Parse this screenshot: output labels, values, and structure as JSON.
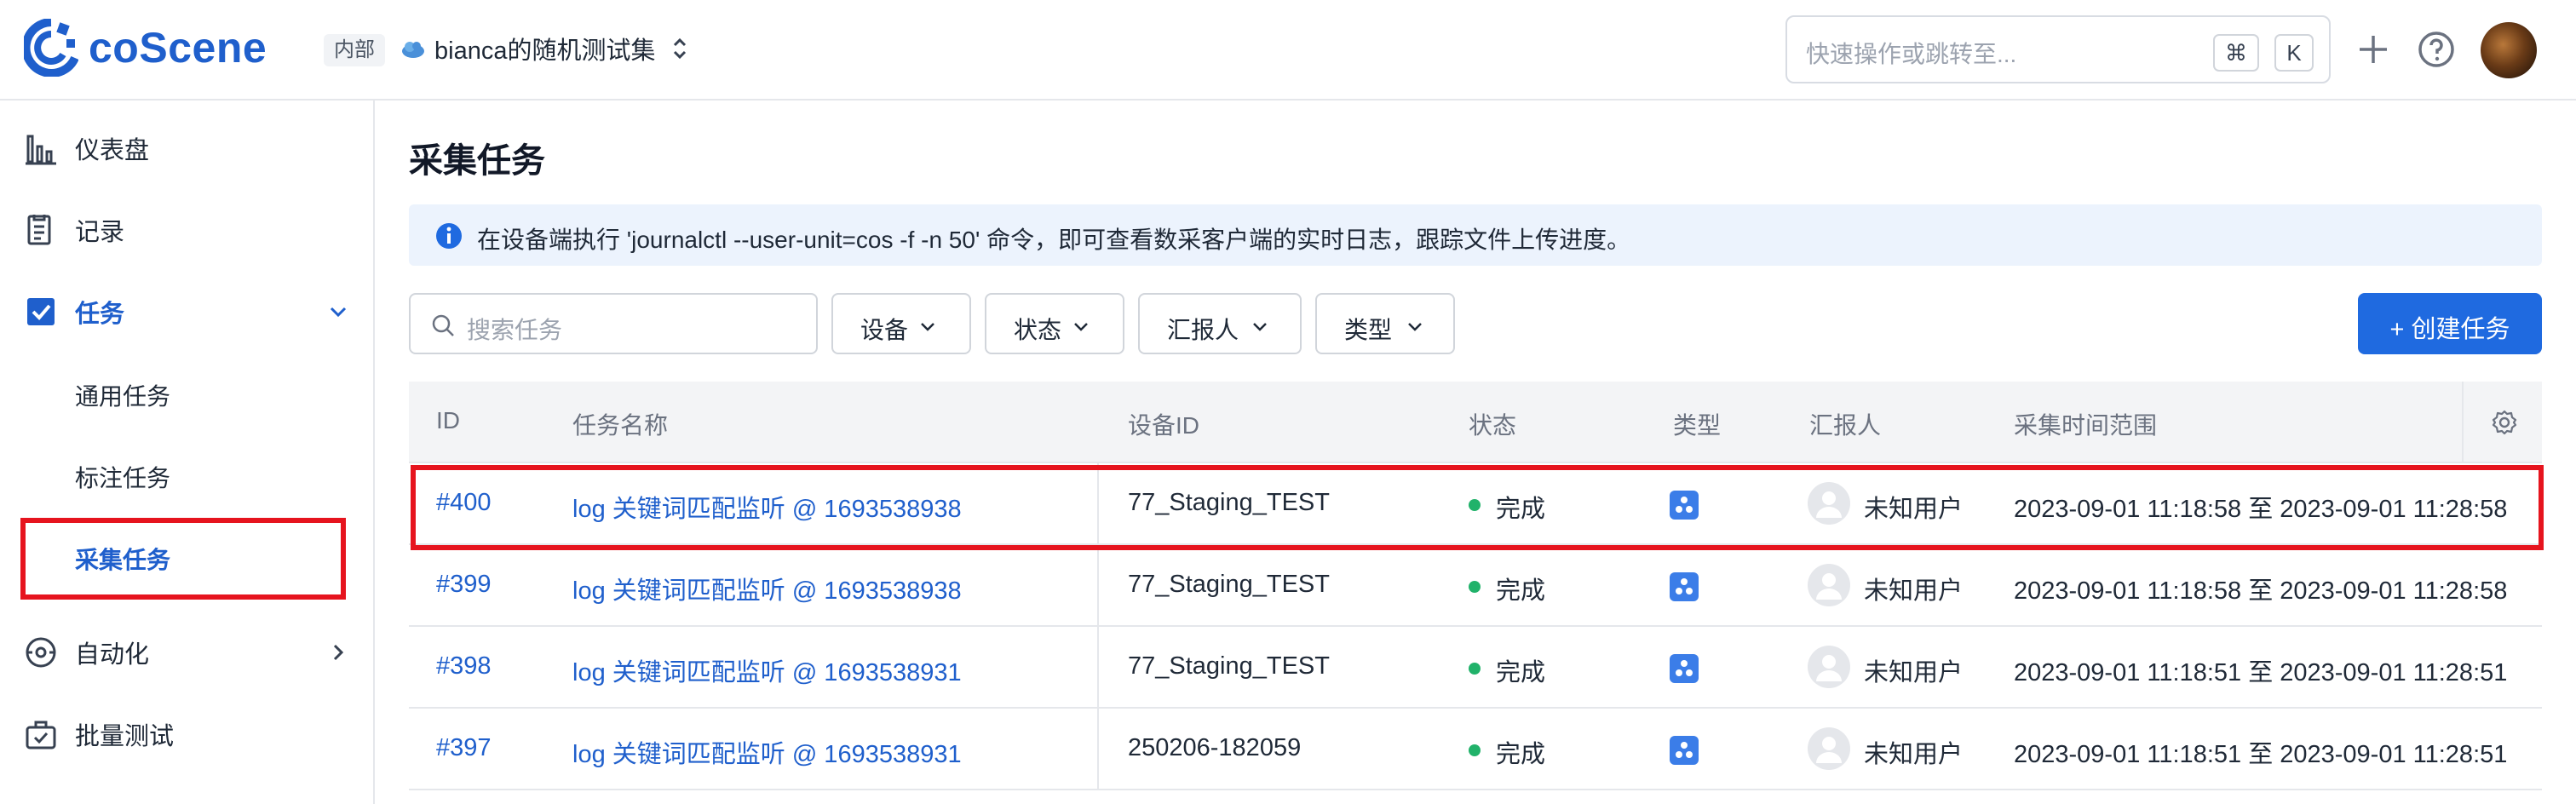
{
  "header": {
    "brand": "coScene",
    "badge": "内部",
    "project_name": "bianca的随机测试集",
    "search_placeholder": "快速操作或跳转至...",
    "shortcut_cmd": "⌘",
    "shortcut_key": "K"
  },
  "sidebar": {
    "items": [
      {
        "label": "仪表盘",
        "icon": "chart-bars-icon"
      },
      {
        "label": "记录",
        "icon": "document-icon"
      },
      {
        "label": "任务",
        "icon": "task-check-icon"
      },
      {
        "label": "自动化",
        "icon": "automation-icon"
      },
      {
        "label": "批量测试",
        "icon": "batch-test-icon"
      }
    ],
    "task_subitems": [
      {
        "label": "通用任务"
      },
      {
        "label": "标注任务"
      },
      {
        "label": "采集任务"
      }
    ]
  },
  "main": {
    "title": "采集任务",
    "info": "在设备端执行 'journalctl --user-unit=cos -f -n 50' 命令，即可查看数采客户端的实时日志，跟踪文件上传进度。",
    "search_placeholder": "搜索任务",
    "filters": [
      "设备",
      "状态",
      "汇报人",
      "类型"
    ],
    "create_button": "+ 创建任务",
    "columns": [
      "ID",
      "任务名称",
      "设备ID",
      "状态",
      "类型",
      "汇报人",
      "采集时间范围"
    ],
    "rows": [
      {
        "id": "#400",
        "name": "log 关键词匹配监听 @ 1693538938",
        "device": "77_Staging_TEST",
        "status": "完成",
        "reporter": "未知用户",
        "range": "2023-09-01 11:18:58 至 2023-09-01 11:28:58"
      },
      {
        "id": "#399",
        "name": "log 关键词匹配监听 @ 1693538938",
        "device": "77_Staging_TEST",
        "status": "完成",
        "reporter": "未知用户",
        "range": "2023-09-01 11:18:58 至 2023-09-01 11:28:58"
      },
      {
        "id": "#398",
        "name": "log 关键词匹配监听 @ 1693538931",
        "device": "77_Staging_TEST",
        "status": "完成",
        "reporter": "未知用户",
        "range": "2023-09-01 11:18:51 至 2023-09-01 11:28:51"
      },
      {
        "id": "#397",
        "name": "log 关键词匹配监听 @ 1693538931",
        "device": "250206-182059",
        "status": "完成",
        "reporter": "未知用户",
        "range": "2023-09-01 11:18:51 至 2023-09-01 11:28:51"
      }
    ]
  },
  "colors": {
    "brand": "#1f5fcc",
    "primary_button": "#1f6ae0",
    "status_done": "#21b26a",
    "highlight": "#e6141e"
  }
}
